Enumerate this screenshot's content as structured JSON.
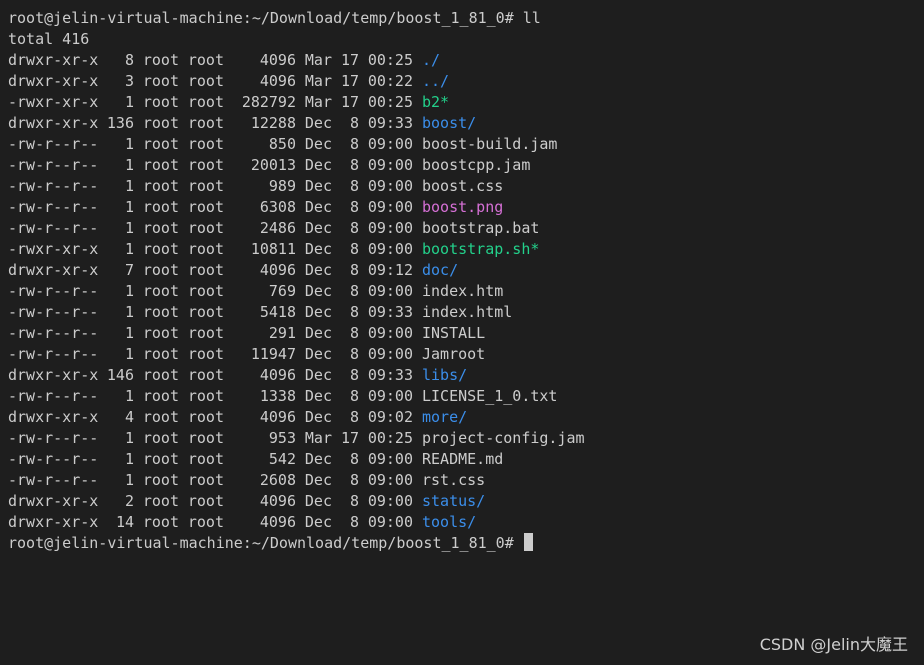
{
  "terminal": {
    "prompt": "root@jelin-virtual-machine:~/Download/temp/boost_1_81_0#",
    "command": "ll",
    "total_line": "total 416",
    "entries": [
      {
        "perm": "drwxr-xr-x",
        "links": "8",
        "owner": "root",
        "group": "root",
        "size": "4096",
        "month": "Mar",
        "day": "17",
        "time": "00:25",
        "name": "./",
        "kind": "dir"
      },
      {
        "perm": "drwxr-xr-x",
        "links": "3",
        "owner": "root",
        "group": "root",
        "size": "4096",
        "month": "Mar",
        "day": "17",
        "time": "00:22",
        "name": "../",
        "kind": "dir"
      },
      {
        "perm": "-rwxr-xr-x",
        "links": "1",
        "owner": "root",
        "group": "root",
        "size": "282792",
        "month": "Mar",
        "day": "17",
        "time": "00:25",
        "name": "b2*",
        "kind": "exec"
      },
      {
        "perm": "drwxr-xr-x",
        "links": "136",
        "owner": "root",
        "group": "root",
        "size": "12288",
        "month": "Dec",
        "day": "8",
        "time": "09:33",
        "name": "boost/",
        "kind": "dir"
      },
      {
        "perm": "-rw-r--r--",
        "links": "1",
        "owner": "root",
        "group": "root",
        "size": "850",
        "month": "Dec",
        "day": "8",
        "time": "09:00",
        "name": "boost-build.jam",
        "kind": "plain"
      },
      {
        "perm": "-rw-r--r--",
        "links": "1",
        "owner": "root",
        "group": "root",
        "size": "20013",
        "month": "Dec",
        "day": "8",
        "time": "09:00",
        "name": "boostcpp.jam",
        "kind": "plain"
      },
      {
        "perm": "-rw-r--r--",
        "links": "1",
        "owner": "root",
        "group": "root",
        "size": "989",
        "month": "Dec",
        "day": "8",
        "time": "09:00",
        "name": "boost.css",
        "kind": "plain"
      },
      {
        "perm": "-rw-r--r--",
        "links": "1",
        "owner": "root",
        "group": "root",
        "size": "6308",
        "month": "Dec",
        "day": "8",
        "time": "09:00",
        "name": "boost.png",
        "kind": "img"
      },
      {
        "perm": "-rw-r--r--",
        "links": "1",
        "owner": "root",
        "group": "root",
        "size": "2486",
        "month": "Dec",
        "day": "8",
        "time": "09:00",
        "name": "bootstrap.bat",
        "kind": "plain"
      },
      {
        "perm": "-rwxr-xr-x",
        "links": "1",
        "owner": "root",
        "group": "root",
        "size": "10811",
        "month": "Dec",
        "day": "8",
        "time": "09:00",
        "name": "bootstrap.sh*",
        "kind": "exec"
      },
      {
        "perm": "drwxr-xr-x",
        "links": "7",
        "owner": "root",
        "group": "root",
        "size": "4096",
        "month": "Dec",
        "day": "8",
        "time": "09:12",
        "name": "doc/",
        "kind": "dir"
      },
      {
        "perm": "-rw-r--r--",
        "links": "1",
        "owner": "root",
        "group": "root",
        "size": "769",
        "month": "Dec",
        "day": "8",
        "time": "09:00",
        "name": "index.htm",
        "kind": "plain"
      },
      {
        "perm": "-rw-r--r--",
        "links": "1",
        "owner": "root",
        "group": "root",
        "size": "5418",
        "month": "Dec",
        "day": "8",
        "time": "09:33",
        "name": "index.html",
        "kind": "plain"
      },
      {
        "perm": "-rw-r--r--",
        "links": "1",
        "owner": "root",
        "group": "root",
        "size": "291",
        "month": "Dec",
        "day": "8",
        "time": "09:00",
        "name": "INSTALL",
        "kind": "plain"
      },
      {
        "perm": "-rw-r--r--",
        "links": "1",
        "owner": "root",
        "group": "root",
        "size": "11947",
        "month": "Dec",
        "day": "8",
        "time": "09:00",
        "name": "Jamroot",
        "kind": "plain"
      },
      {
        "perm": "drwxr-xr-x",
        "links": "146",
        "owner": "root",
        "group": "root",
        "size": "4096",
        "month": "Dec",
        "day": "8",
        "time": "09:33",
        "name": "libs/",
        "kind": "dir"
      },
      {
        "perm": "-rw-r--r--",
        "links": "1",
        "owner": "root",
        "group": "root",
        "size": "1338",
        "month": "Dec",
        "day": "8",
        "time": "09:00",
        "name": "LICENSE_1_0.txt",
        "kind": "plain"
      },
      {
        "perm": "drwxr-xr-x",
        "links": "4",
        "owner": "root",
        "group": "root",
        "size": "4096",
        "month": "Dec",
        "day": "8",
        "time": "09:02",
        "name": "more/",
        "kind": "dir"
      },
      {
        "perm": "-rw-r--r--",
        "links": "1",
        "owner": "root",
        "group": "root",
        "size": "953",
        "month": "Mar",
        "day": "17",
        "time": "00:25",
        "name": "project-config.jam",
        "kind": "plain"
      },
      {
        "perm": "-rw-r--r--",
        "links": "1",
        "owner": "root",
        "group": "root",
        "size": "542",
        "month": "Dec",
        "day": "8",
        "time": "09:00",
        "name": "README.md",
        "kind": "plain"
      },
      {
        "perm": "-rw-r--r--",
        "links": "1",
        "owner": "root",
        "group": "root",
        "size": "2608",
        "month": "Dec",
        "day": "8",
        "time": "09:00",
        "name": "rst.css",
        "kind": "plain"
      },
      {
        "perm": "drwxr-xr-x",
        "links": "2",
        "owner": "root",
        "group": "root",
        "size": "4096",
        "month": "Dec",
        "day": "8",
        "time": "09:00",
        "name": "status/",
        "kind": "dir"
      },
      {
        "perm": "drwxr-xr-x",
        "links": "14",
        "owner": "root",
        "group": "root",
        "size": "4096",
        "month": "Dec",
        "day": "8",
        "time": "09:00",
        "name": "tools/",
        "kind": "dir"
      }
    ]
  },
  "watermark": "CSDN @Jelin大魔王",
  "colors": {
    "background": "#1e1e1e",
    "text": "#cccccc",
    "directory": "#3b8eea",
    "executable": "#23d18b",
    "image": "#d670d6"
  }
}
